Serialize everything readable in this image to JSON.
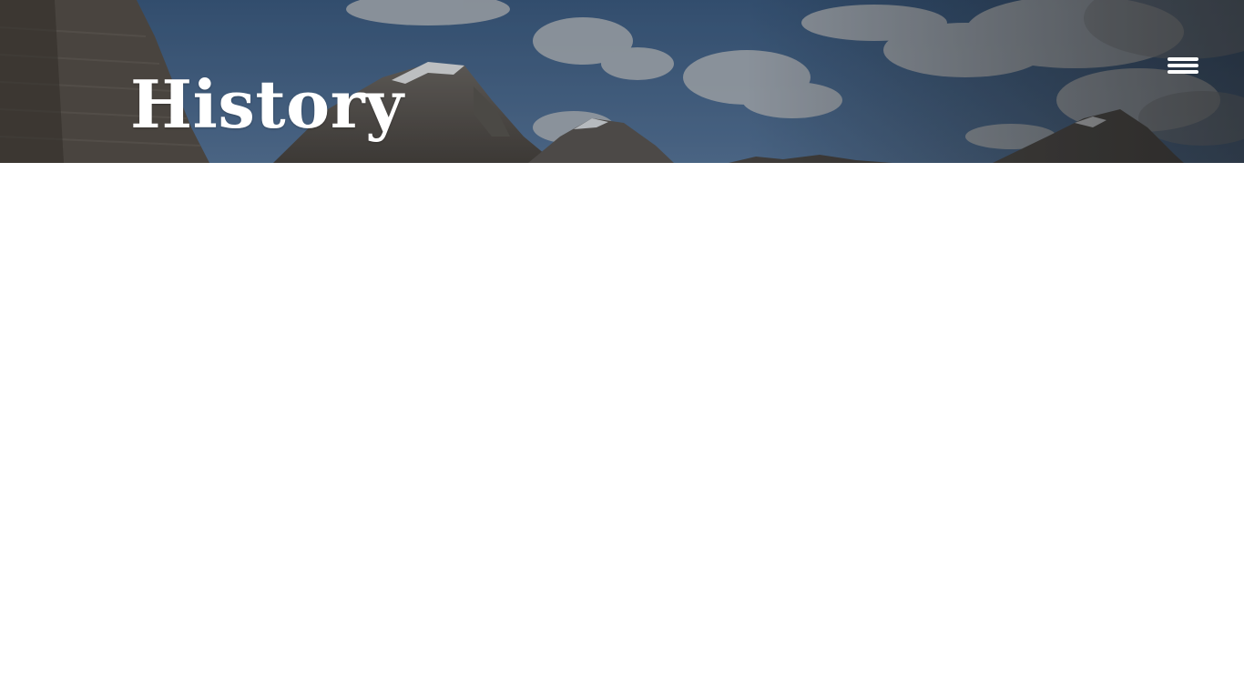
{
  "hero": {
    "title": "History",
    "background": "mountain-landscape-image"
  },
  "header": {
    "menu_icon": "hamburger-menu-icon"
  },
  "colors": {
    "title_text": "#ffffff",
    "sky": "#4a6f9c",
    "page_background": "#ffffff"
  }
}
